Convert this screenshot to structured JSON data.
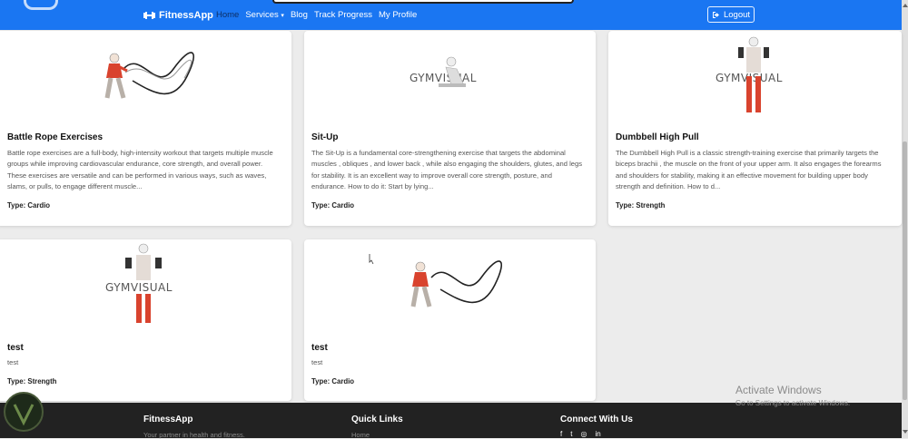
{
  "navbar": {
    "brand": "FitnessApp",
    "links": [
      "Home",
      "Services",
      "Blog",
      "Track Progress",
      "My Profile"
    ],
    "services_caret": "▾",
    "logout_label": "Logout"
  },
  "cards": [
    {
      "title": "Battle Rope Exercises",
      "description": "Battle rope exercises are a full-body, high-intensity workout that targets multiple muscle groups while improving cardiovascular endurance, core strength, and overall power. These exercises are versatile and can be performed in various ways, such as waves, slams, or pulls, to engage different muscle...",
      "type": "Type: Cardio"
    },
    {
      "title": "Sit-Up",
      "description": "The Sit-Up is a fundamental core-strengthening exercise that targets the abdominal muscles , obliques , and lower back , while also engaging the shoulders, glutes, and legs for stability. It is an excellent way to improve overall core strength, posture, and endurance. How to do it: Start by lying...",
      "type": "Type: Cardio",
      "image_text": "GYMVISUAL"
    },
    {
      "title": "Dumbbell High Pull",
      "description": "The Dumbbell High Pull is a classic strength-training exercise that primarily targets the biceps brachii , the muscle on the front of your upper arm. It also engages the forearms and shoulders for stability, making it an effective movement for building upper body strength and definition. How to d...",
      "type": "Type: Strength",
      "image_text": "GYMVISUAL"
    },
    {
      "title": "test",
      "description": "test",
      "type": "Type: Strength",
      "image_text": "GYMVISUAL"
    },
    {
      "title": "test",
      "description": "test",
      "type": "Type: Cardio"
    }
  ],
  "footer": {
    "brand": "FitnessApp",
    "tagline": "Your partner in health and fitness.",
    "quick_links_title": "Quick Links",
    "quick_link_first": "Home",
    "connect_title": "Connect With Us",
    "social_icons": [
      "f",
      "t",
      "◎",
      "in"
    ]
  },
  "os_overlay": {
    "title": "Activate Windows",
    "subtitle": "Go to Settings to activate Windows."
  },
  "colors": {
    "navbar": "#1a76f2",
    "footer": "#222222",
    "muscle_highlight": "#d9432e"
  }
}
